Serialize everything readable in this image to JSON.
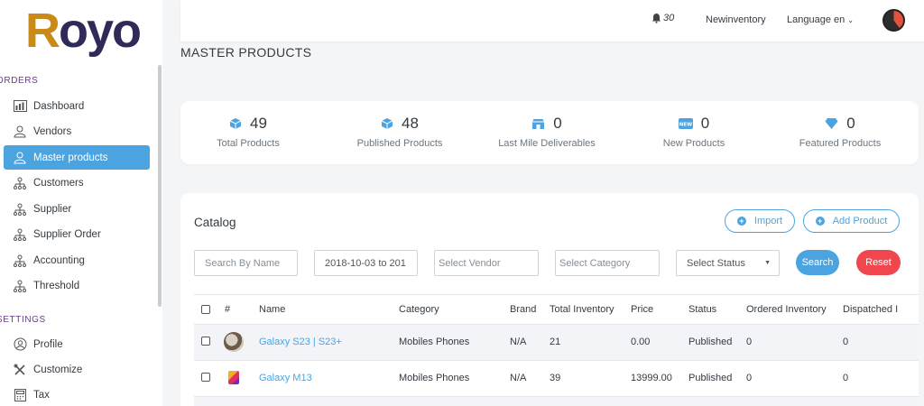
{
  "logo": {
    "text_r": "R",
    "text_rest": "oyo"
  },
  "sidebar": {
    "section_orders": "ORDERS",
    "section_settings": "SETTINGS",
    "items": [
      {
        "label": "Dashboard",
        "icon": "dashboard-icon"
      },
      {
        "label": "Vendors",
        "icon": "vendors-icon"
      },
      {
        "label": "Master products",
        "icon": "master-products-icon",
        "active": true
      },
      {
        "label": "Customers",
        "icon": "customers-icon"
      },
      {
        "label": "Supplier",
        "icon": "supplier-icon"
      },
      {
        "label": "Supplier Order",
        "icon": "supplier-order-icon"
      },
      {
        "label": "Accounting",
        "icon": "accounting-icon"
      },
      {
        "label": "Threshold",
        "icon": "threshold-icon"
      },
      {
        "label": "Profile",
        "icon": "profile-icon"
      },
      {
        "label": "Customize",
        "icon": "customize-icon"
      },
      {
        "label": "Tax",
        "icon": "tax-icon"
      }
    ]
  },
  "topbar": {
    "notifications": "30",
    "store": "Newinventory",
    "language": "Language en"
  },
  "page": {
    "title": "MASTER PRODUCTS"
  },
  "stats": [
    {
      "value": "49",
      "label": "Total Products",
      "icon": "cube-icon"
    },
    {
      "value": "48",
      "label": "Published Products",
      "icon": "cube-icon"
    },
    {
      "value": "0",
      "label": "Last Mile Deliverables",
      "icon": "store-icon"
    },
    {
      "value": "0",
      "label": "New Products",
      "icon": "new-badge-icon"
    },
    {
      "value": "0",
      "label": "Featured Products",
      "icon": "diamond-icon"
    }
  ],
  "catalog": {
    "title": "Catalog",
    "import_label": "Import",
    "add_product_label": "Add Product",
    "filters": {
      "search_placeholder": "Search By Name",
      "date_value": "2018-10-03 to 201",
      "vendor_placeholder": "Select Vendor",
      "category_placeholder": "Select Category",
      "status_placeholder": "Select Status"
    },
    "search_label": "Search",
    "reset_label": "Reset",
    "columns": [
      "#",
      "Name",
      "Category",
      "Brand",
      "Total Inventory",
      "Price",
      "Status",
      "Ordered Inventory",
      "Dispatched I"
    ],
    "rows": [
      {
        "name": "Galaxy S23 | S23+",
        "category": "Mobiles Phones",
        "brand": "N/A",
        "total_inventory": "21",
        "price": "0.00",
        "status": "Published",
        "ordered": "0",
        "dispatched": "0"
      },
      {
        "name": "Galaxy M13",
        "category": "Mobiles Phones",
        "brand": "N/A",
        "total_inventory": "39",
        "price": "13999.00",
        "status": "Published",
        "ordered": "0",
        "dispatched": "0"
      }
    ]
  },
  "colors": {
    "accent": "#4ba4e0",
    "reset": "#f0474f",
    "logo_r": "#c98a1a",
    "logo_rest": "#2f2a57"
  }
}
